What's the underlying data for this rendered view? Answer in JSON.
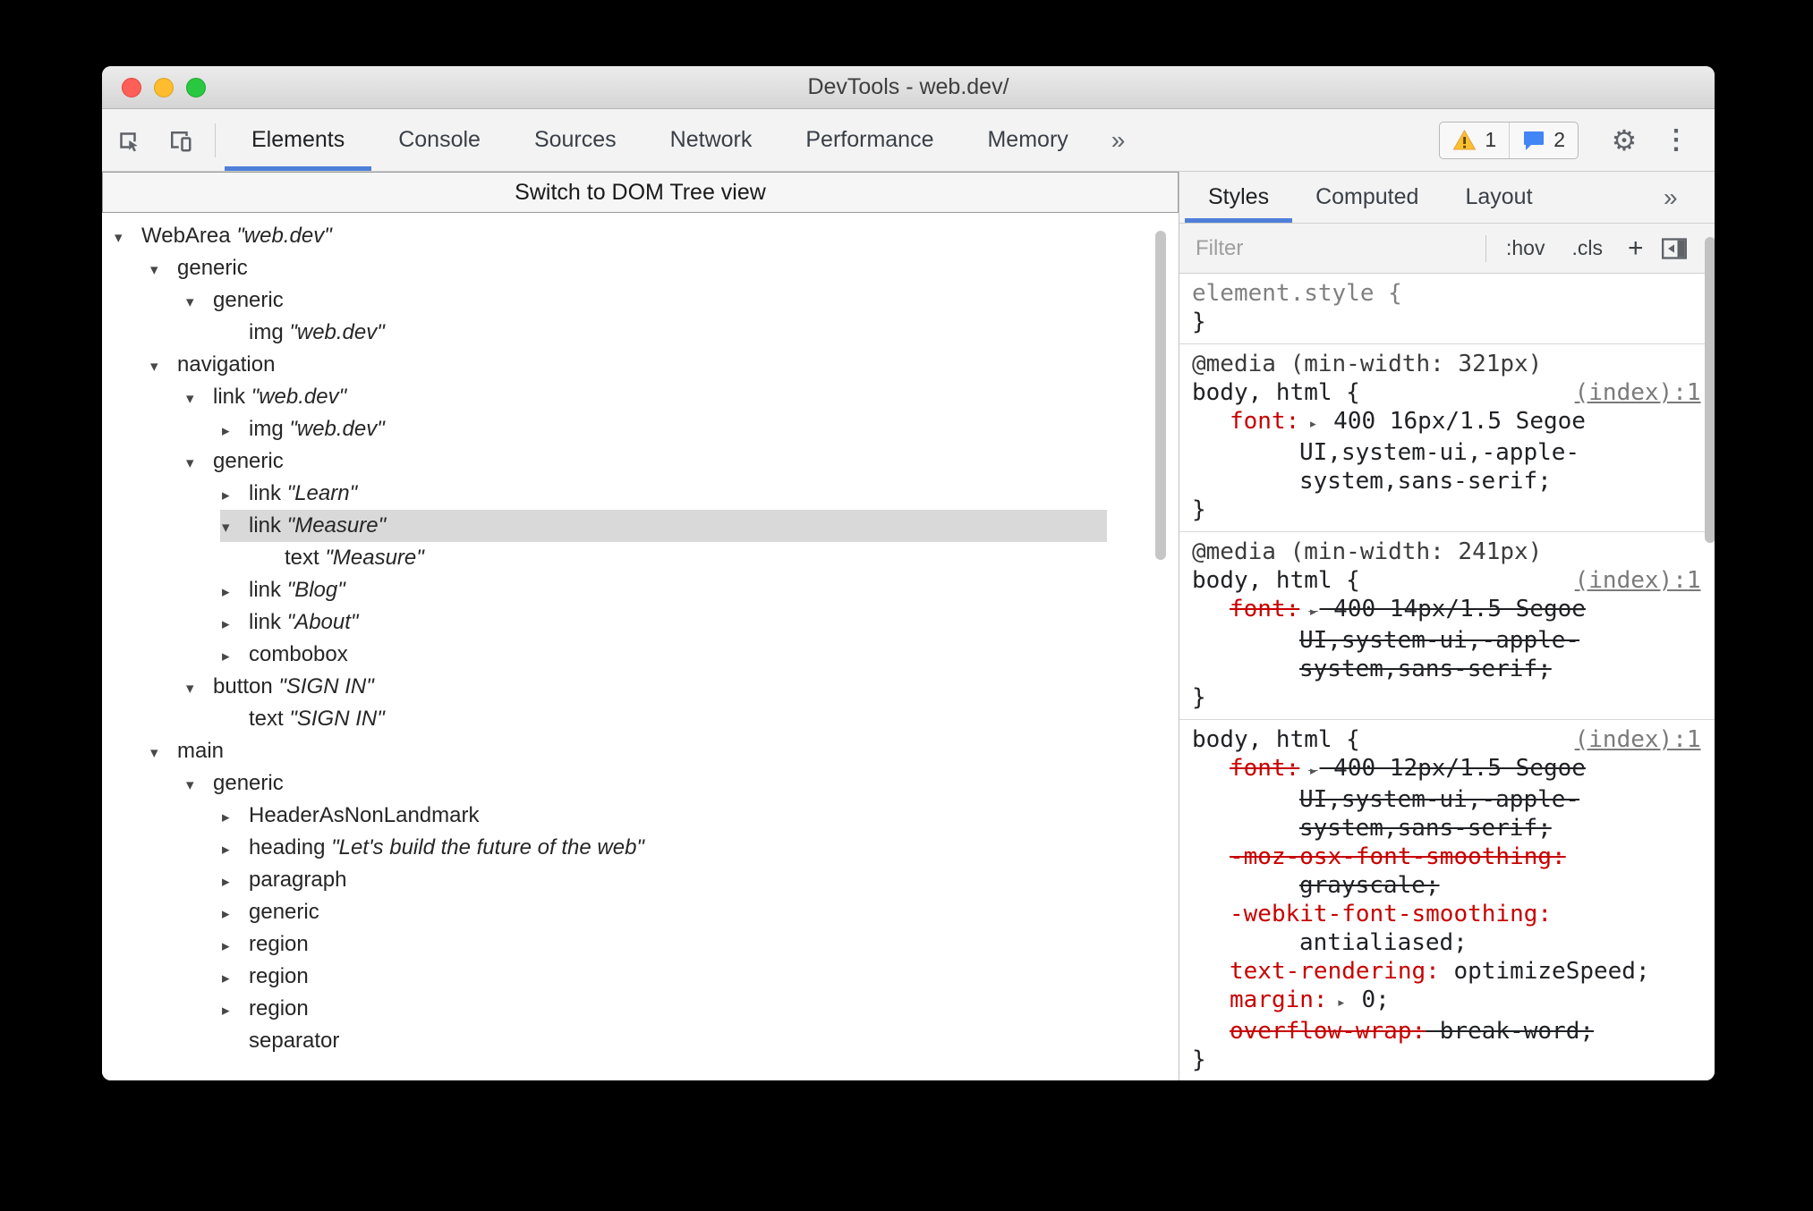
{
  "window": {
    "title": "DevTools - web.dev/"
  },
  "toolbar": {
    "tabs": [
      {
        "label": "Elements",
        "active": true
      },
      {
        "label": "Console",
        "active": false
      },
      {
        "label": "Sources",
        "active": false
      },
      {
        "label": "Network",
        "active": false
      },
      {
        "label": "Performance",
        "active": false
      },
      {
        "label": "Memory",
        "active": false
      }
    ],
    "more_tabs": "»",
    "warning_count": "1",
    "message_count": "2"
  },
  "left_panel": {
    "switch_button": "Switch to DOM Tree view",
    "tree": [
      {
        "level": 0,
        "expand": "open",
        "role": "WebArea",
        "name": "web.dev"
      },
      {
        "level": 1,
        "expand": "open",
        "role": "generic",
        "name": null
      },
      {
        "level": 2,
        "expand": "open",
        "role": "generic",
        "name": null
      },
      {
        "level": 3,
        "expand": "none",
        "role": "img",
        "name": "web.dev"
      },
      {
        "level": 1,
        "expand": "open",
        "role": "navigation",
        "name": null
      },
      {
        "level": 2,
        "expand": "open",
        "role": "link",
        "name": "web.dev"
      },
      {
        "level": 3,
        "expand": "closed",
        "role": "img",
        "name": "web.dev"
      },
      {
        "level": 2,
        "expand": "open",
        "role": "generic",
        "name": null
      },
      {
        "level": 3,
        "expand": "closed",
        "role": "link",
        "name": "Learn"
      },
      {
        "level": 3,
        "expand": "open",
        "role": "link",
        "name": "Measure",
        "selected": true
      },
      {
        "level": 4,
        "expand": "none",
        "role": "text",
        "name": "Measure"
      },
      {
        "level": 3,
        "expand": "closed",
        "role": "link",
        "name": "Blog"
      },
      {
        "level": 3,
        "expand": "closed",
        "role": "link",
        "name": "About"
      },
      {
        "level": 3,
        "expand": "closed",
        "role": "combobox",
        "name": null
      },
      {
        "level": 2,
        "expand": "open",
        "role": "button",
        "name": "SIGN IN"
      },
      {
        "level": 3,
        "expand": "none",
        "role": "text",
        "name": "SIGN IN"
      },
      {
        "level": 1,
        "expand": "open",
        "role": "main",
        "name": null
      },
      {
        "level": 2,
        "expand": "open",
        "role": "generic",
        "name": null
      },
      {
        "level": 3,
        "expand": "closed",
        "role": "HeaderAsNonLandmark",
        "name": null
      },
      {
        "level": 3,
        "expand": "closed",
        "role": "heading",
        "name": "Let's build the future of the web"
      },
      {
        "level": 3,
        "expand": "closed",
        "role": "paragraph",
        "name": null
      },
      {
        "level": 3,
        "expand": "closed",
        "role": "generic",
        "name": null
      },
      {
        "level": 3,
        "expand": "closed",
        "role": "region",
        "name": null
      },
      {
        "level": 3,
        "expand": "closed",
        "role": "region",
        "name": null
      },
      {
        "level": 3,
        "expand": "closed",
        "role": "region",
        "name": null
      },
      {
        "level": 3,
        "expand": "none",
        "role": "separator",
        "name": null
      }
    ]
  },
  "right_panel": {
    "tabs": [
      {
        "label": "Styles",
        "active": true
      },
      {
        "label": "Computed",
        "active": false
      },
      {
        "label": "Layout",
        "active": false
      }
    ],
    "more_tabs": "»",
    "filter_placeholder": "Filter",
    "pseudo_toggle": ":hov",
    "class_toggle": ".cls",
    "new_rule": "+",
    "brace_open": "{",
    "brace_close": "}",
    "sections": [
      {
        "media": null,
        "selector": "element.style",
        "selector_muted": true,
        "link": null,
        "declarations": []
      },
      {
        "media": "@media (min-width: 321px)",
        "selector": "body, html",
        "selector_muted": false,
        "link": "(index):1",
        "declarations": [
          {
            "name": "font",
            "value": "400 16px/1.5 Segoe UI,system-ui,-apple-system,sans-serif;",
            "arrow": true,
            "struck": false
          }
        ]
      },
      {
        "media": "@media (min-width: 241px)",
        "selector": "body, html",
        "selector_muted": false,
        "link": "(index):1",
        "declarations": [
          {
            "name": "font",
            "value": "400 14px/1.5 Segoe UI,system-ui,-apple-system,sans-serif;",
            "arrow": true,
            "struck": true
          }
        ]
      },
      {
        "media": null,
        "selector": "body, html",
        "selector_muted": false,
        "link": "(index):1",
        "declarations": [
          {
            "name": "font",
            "value": "400 12px/1.5 Segoe UI,system-ui,-apple-system,sans-serif;",
            "arrow": true,
            "struck": true
          },
          {
            "name": "-moz-osx-font-smoothing",
            "value": "grayscale;",
            "arrow": false,
            "struck": true
          },
          {
            "name": "-webkit-font-smoothing",
            "value": "antialiased;",
            "arrow": false,
            "struck": false
          },
          {
            "name": "text-rendering",
            "value": "optimizeSpeed;",
            "arrow": false,
            "struck": false
          },
          {
            "name": "margin",
            "value": "0;",
            "arrow": true,
            "struck": false
          },
          {
            "name": "overflow-wrap",
            "value": "break-word;",
            "arrow": false,
            "struck": true
          }
        ]
      }
    ]
  },
  "icons": {
    "inspect": "inspect-cursor",
    "device_toolbar": "device-frame",
    "warning": "warning-triangle",
    "message": "speech-bubble",
    "dock": "sidebar-toggle",
    "gear_glyph": "⚙",
    "kebab_glyph": "⋮",
    "expand_open_glyph": "▾",
    "expand_closed_glyph": "▸"
  },
  "colors": {
    "accent": "#4e7fd9",
    "property": "#c80000",
    "selection": "#d9d9d9",
    "warning": "#fbc02d",
    "message": "#4285f4"
  }
}
